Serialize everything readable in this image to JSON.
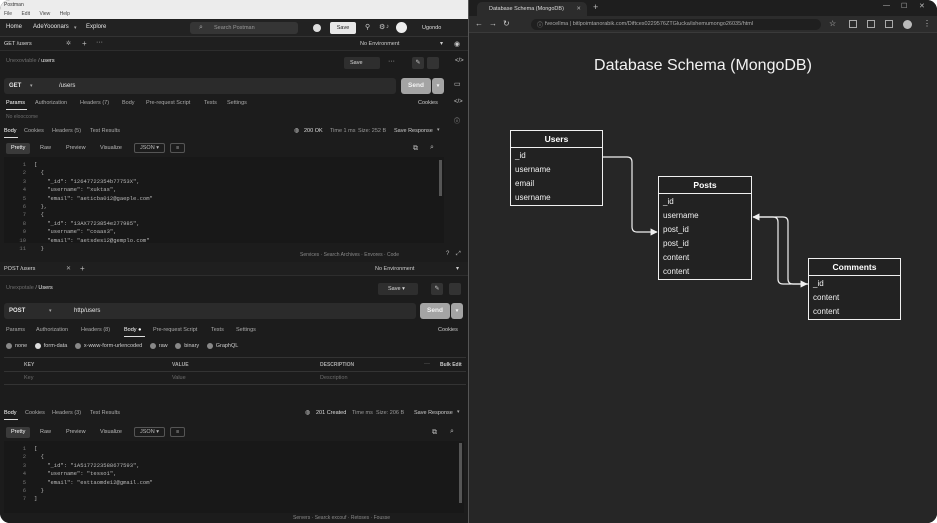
{
  "postman": {
    "title": "Postman",
    "menu": [
      "File",
      "Edit",
      "View",
      "Help"
    ],
    "nav_home": "Home",
    "workspace": "AdeYooonars",
    "nav_explore": "Explore",
    "search_placeholder": "Search Postman",
    "save_top": "Save",
    "user": "Ugondo",
    "env": "No Environment",
    "env2": "No Environment",
    "req1": {
      "tab": "GET /users",
      "breadcrumb_ws": "Unexovtable",
      "breadcrumb_item": "users",
      "save": "Save",
      "method": "GET",
      "url": "/users",
      "send": "Send",
      "subtabs": [
        "Params",
        "Authorization",
        "Headers (7)",
        "Body",
        "Pre-request Script",
        "Tests",
        "Settings"
      ],
      "cookies": "Cookies",
      "params_note": "No elooccome",
      "resp_tabs": [
        "Body",
        "Cookies",
        "Headers (5)",
        "Test Results"
      ],
      "status": "200 OK",
      "time": "Time 1 ms",
      "size": "Size: 252 B",
      "save_response": "Save Response",
      "view_tabs": [
        "Pretty",
        "Raw",
        "Preview",
        "Visualize"
      ],
      "format": "JSON",
      "lines": [
        {
          "n": "1",
          "t": "["
        },
        {
          "n": "2",
          "t": "  {"
        },
        {
          "n": "3",
          "t": "    \"_id\": \"12647722354b77753X\","
        },
        {
          "n": "4",
          "t": "    \"username\": \"xuktas\","
        },
        {
          "n": "5",
          "t": "    \"email\": \"aeticba012@gaeple.com\""
        },
        {
          "n": "6",
          "t": "  },"
        },
        {
          "n": "7",
          "t": "  {"
        },
        {
          "n": "8",
          "t": "    \"_id\": \"13AX7723854e277985\","
        },
        {
          "n": "9",
          "t": "    \"username\": \"coaas3\","
        },
        {
          "n": "10",
          "t": "    \"email\": \"aetsdes12@gemplo.com\""
        },
        {
          "n": "11",
          "t": "  }"
        }
      ],
      "status_items": [
        "Services",
        "Search Archives",
        "Envores",
        "Code"
      ]
    },
    "req2": {
      "tab": "POST /users",
      "breadcrumb_ws": "Unexpotale",
      "breadcrumb_item": "Users",
      "save": "Save",
      "method": "POST",
      "url": "http/users",
      "send": "Send",
      "subtabs": [
        "Params",
        "Authorization",
        "Headers (8)",
        "Body ●",
        "Pre-request Script",
        "Tests",
        "Settings"
      ],
      "cookies": "Cookies",
      "body_types": [
        "none",
        "form-data",
        "x-www-form-urlencoded",
        "raw",
        "binary",
        "GraphQL"
      ],
      "table_headers": [
        "KEY",
        "VALUE",
        "DESCRIPTION"
      ],
      "bulk_edit": "Bulk Edit",
      "placeholders": [
        "Key",
        "Value",
        "Description"
      ],
      "resp_tabs": [
        "Body",
        "Cookies",
        "Headers (3)",
        "Test Results"
      ],
      "status": "201 Created",
      "time": "Time ms",
      "size": "Size: 206 B",
      "save_response": "Save Response",
      "view_tabs": [
        "Pretty",
        "Raw",
        "Preview",
        "Visualize"
      ],
      "format": "JSON",
      "lines": [
        {
          "n": "1",
          "t": "["
        },
        {
          "n": "2",
          "t": "  {"
        },
        {
          "n": "3",
          "t": "    \"_id\": \"1A5177223588677593\","
        },
        {
          "n": "4",
          "t": "    \"username\": \"tesso1\","
        },
        {
          "n": "5",
          "t": "    \"email\": \"esttaomde12@gmail.com\""
        },
        {
          "n": "6",
          "t": "  }"
        },
        {
          "n": "7",
          "t": "]"
        }
      ],
      "status_items": [
        "Servers",
        "Searck excouf",
        "Retoses",
        "Fousse"
      ]
    }
  },
  "browser": {
    "tab_title": "Database Schema (MongoDB)",
    "url": "fvecellma | bitlpoimtanorabik.com/Diftces0229576ZTGlucka/ishemumongo26035/html"
  },
  "schema": {
    "title": "Database Schema (MongoDB)",
    "entities": [
      {
        "name": "Users",
        "fields": [
          "_id",
          "username",
          "email",
          "username"
        ]
      },
      {
        "name": "Posts",
        "fields": [
          "_id",
          "username",
          "post_id",
          "post_id",
          "content",
          "content"
        ]
      },
      {
        "name": "Comments",
        "fields": [
          "_id",
          "content",
          "content"
        ]
      }
    ]
  },
  "colors": {
    "accent": "#a4a4a4",
    "background": "#1c1c1c",
    "schema_bg": "#262626",
    "stroke": "#f0f0f0"
  }
}
